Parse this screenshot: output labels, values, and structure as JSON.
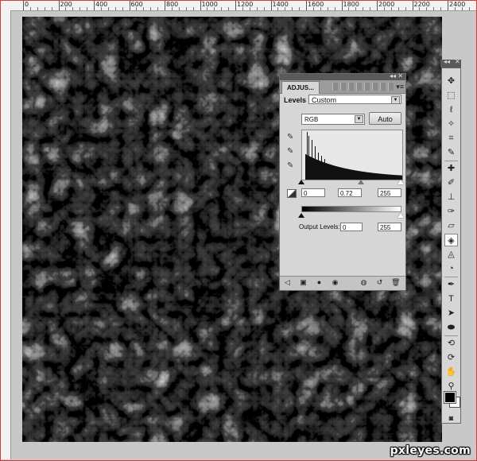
{
  "ruler": {
    "labels": [
      "0",
      "200",
      "400",
      "600",
      "800",
      "1000",
      "1200",
      "1400",
      "1600",
      "1800",
      "2000",
      "2200",
      "2400"
    ]
  },
  "adjustments_panel": {
    "tab_label": "ADJUS...",
    "levels_label": "Levels",
    "preset_value": "Custom",
    "channel_value": "RGB",
    "auto_label": "Auto",
    "input_black": "0",
    "input_gamma": "0.72",
    "input_white": "255",
    "output_label": "Output Levels:",
    "output_black": "0",
    "output_white": "255",
    "input_levels": {
      "black": 0,
      "gamma": 0.72,
      "white": 255
    },
    "output_levels": {
      "black": 0,
      "white": 255
    }
  },
  "toolbar": {
    "tools": [
      "move-icon",
      "marquee-icon",
      "lasso-icon",
      "quick-select-icon",
      "crop-icon",
      "eyedropper-icon",
      "healing-icon",
      "brush-icon",
      "clone-stamp-icon",
      "history-brush-icon",
      "eraser-icon",
      "paint-bucket-icon",
      "blur-icon",
      "dodge-icon",
      "pen-icon",
      "type-icon",
      "path-select-icon",
      "ellipse-icon",
      "3d-rotate-icon",
      "3d-orbit-icon",
      "hand-icon",
      "zoom-icon"
    ],
    "active_tool": "paint-bucket-icon",
    "foreground_color": "#000000",
    "background_color": "#ffffff"
  },
  "watermark": "pxleyes.com"
}
